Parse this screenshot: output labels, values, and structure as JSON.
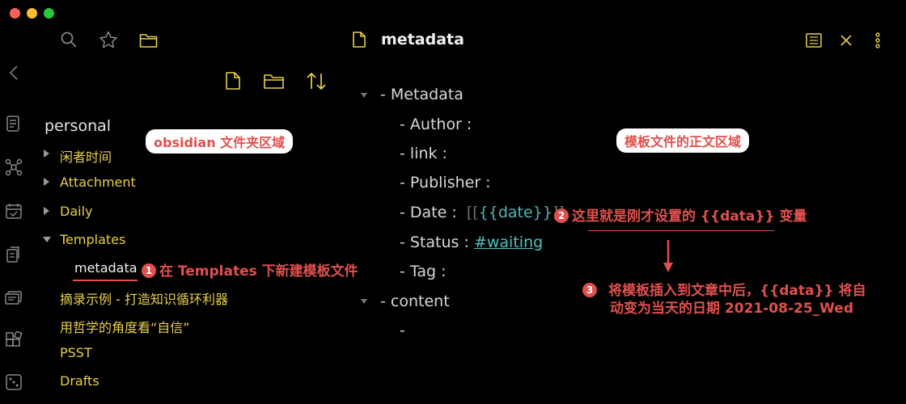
{
  "window": {
    "traffic_lights": [
      "#ff5f57",
      "#febc2e",
      "#28c840"
    ]
  },
  "accent_yellow": "#e8cf4a",
  "annotation_red": "#e0504d",
  "tab": {
    "title": "metadata"
  },
  "vault": {
    "name": "personal",
    "items": [
      {
        "label": "闲者时间",
        "expanded": false,
        "has_arrow": true
      },
      {
        "label": "Attachment",
        "expanded": false,
        "has_arrow": true
      },
      {
        "label": "Daily",
        "expanded": false,
        "has_arrow": true
      },
      {
        "label": "Templates",
        "expanded": true,
        "has_arrow": true
      },
      {
        "label": "metadata",
        "has_arrow": false,
        "active": true
      },
      {
        "label": "摘录示例 - 打造知识循环利器",
        "has_arrow": false
      },
      {
        "label": "用哲学的角度看“自信”",
        "has_arrow": false
      },
      {
        "label": "PSST",
        "has_arrow": false
      },
      {
        "label": "Drafts",
        "has_arrow": false
      }
    ]
  },
  "editor": {
    "lines": {
      "metadata": "Metadata",
      "author": "Author :",
      "link": "link :",
      "publisher": "Publisher :",
      "date_label": "Date :",
      "date_open": "[[",
      "date_template": "{{date}}",
      "date_close": "]]",
      "status_label": "Status :",
      "status_tag": "#waiting",
      "tag": "Tag :",
      "content": "content",
      "dash": "-"
    }
  },
  "annotations": {
    "folder_area": "obsidian 文件夹区域",
    "body_area": "模板文件的正文区域",
    "a1_num": "1",
    "a1_text": "在 Templates 下新建模板文件",
    "a2_num": "2",
    "a2_text": "这里就是刚才设置的 {{data}} 变量",
    "a3_num": "3",
    "a3_line1": "将模板插入到文章中后，{{data}} 将自",
    "a3_line2": "动变为当天的日期 2021-08-25_Wed"
  }
}
